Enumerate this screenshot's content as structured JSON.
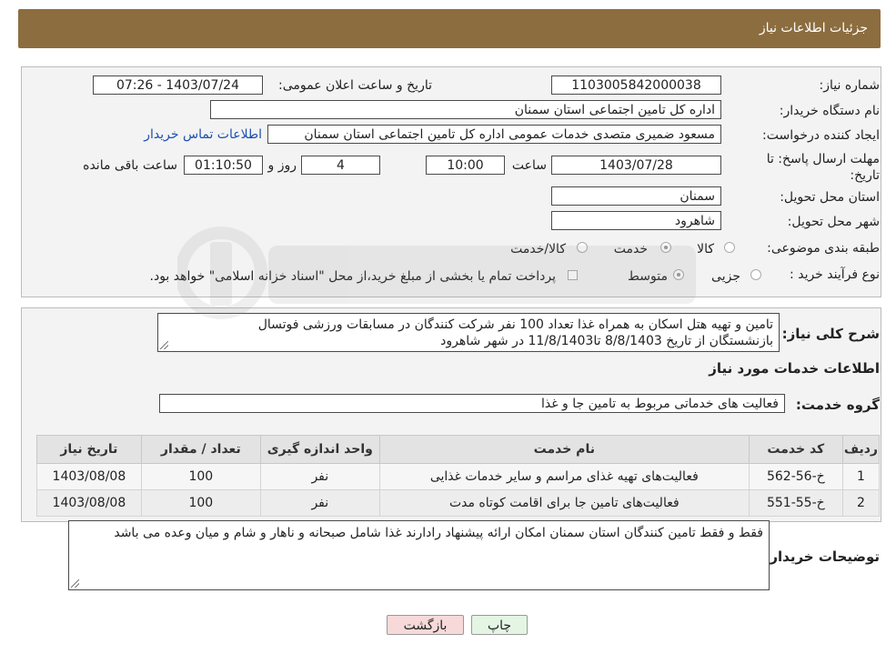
{
  "header": {
    "title": "جزئیات اطلاعات نیاز"
  },
  "info": {
    "need_number_label": "شماره نیاز:",
    "need_number": "1103005842000038",
    "announce_label": "تاریخ و ساعت اعلان عمومی:",
    "announce_value": "1403/07/24 - 07:26",
    "buyer_org_label": "نام دستگاه خریدار:",
    "buyer_org": "اداره کل تامین اجتماعی استان سمنان",
    "creator_label": "ایجاد کننده درخواست:",
    "creator": "مسعود ضمیری متصدی خدمات عمومی اداره کل تامین اجتماعی استان سمنان",
    "contact_link": "اطلاعات تماس خریدار",
    "deadline_label": "مهلت ارسال پاسخ: تا تاریخ:",
    "deadline_date": "1403/07/28",
    "time_label": "ساعت",
    "deadline_time": "10:00",
    "days": "4",
    "days_label": "روز و",
    "remaining": "01:10:50",
    "remaining_label": "ساعت باقی مانده",
    "province_label": "استان محل تحویل:",
    "province": "سمنان",
    "city_label": "شهر محل تحویل:",
    "city": "شاهرود",
    "category_label": "طبقه بندی موضوعی:",
    "category_options": [
      "کالا",
      "خدمت",
      "کالا/خدمت"
    ],
    "category_selected": "خدمت",
    "purchase_type_label": "نوع فرآیند خرید :",
    "purchase_options": [
      "جزیی",
      "متوسط"
    ],
    "purchase_selected": "متوسط",
    "treasury_note": "پرداخت تمام یا بخشی از مبلغ خرید،از محل \"اسناد خزانه اسلامی\" خواهد بود."
  },
  "summary": {
    "label": "شرح کلی نیاز:",
    "text_line1": "تامین و تهیه هتل اسکان به همراه غذا  تعداد 100 نفر شرکت کنندگان در مسابقات ورزشی فوتسال",
    "text_line2": "بازنشستگان از تاریخ 8/8/1403 تا11/8/1403 در شهر شاهرود"
  },
  "services": {
    "section_title": "اطلاعات خدمات مورد نیاز",
    "group_label": "گروه خدمت:",
    "group_value": "فعالیت های خدماتی مربوط به تامین جا و غذا",
    "headers": [
      "ردیف",
      "کد خدمت",
      "نام خدمت",
      "واحد اندازه گیری",
      "تعداد / مقدار",
      "تاریخ نیاز"
    ],
    "rows": [
      [
        "1",
        "خ-56-562",
        "فعالیت‌های تهیه غذای مراسم و سایر خدمات غذایی",
        "نفر",
        "100",
        "1403/08/08"
      ],
      [
        "2",
        "خ-55-551",
        "فعالیت‌های تامین جا برای اقامت کوتاه مدت",
        "نفر",
        "100",
        "1403/08/08"
      ]
    ]
  },
  "buyer_notes": {
    "label": "توضیحات خریدار:",
    "text": "فقط و فقط تامین کنندگان استان سمنان امکان ارائه پیشنهاد رادارند غذا شامل صبحانه و ناهار و شام و میان وعده می باشد"
  },
  "buttons": {
    "print": "چاپ",
    "back": "بازگشت"
  },
  "colors": {
    "header_bg": "#8c6d3f",
    "link": "#1a4fb3",
    "back_button_bg": "#f7d9d9",
    "print_button_bg": "#e4f5e4"
  }
}
